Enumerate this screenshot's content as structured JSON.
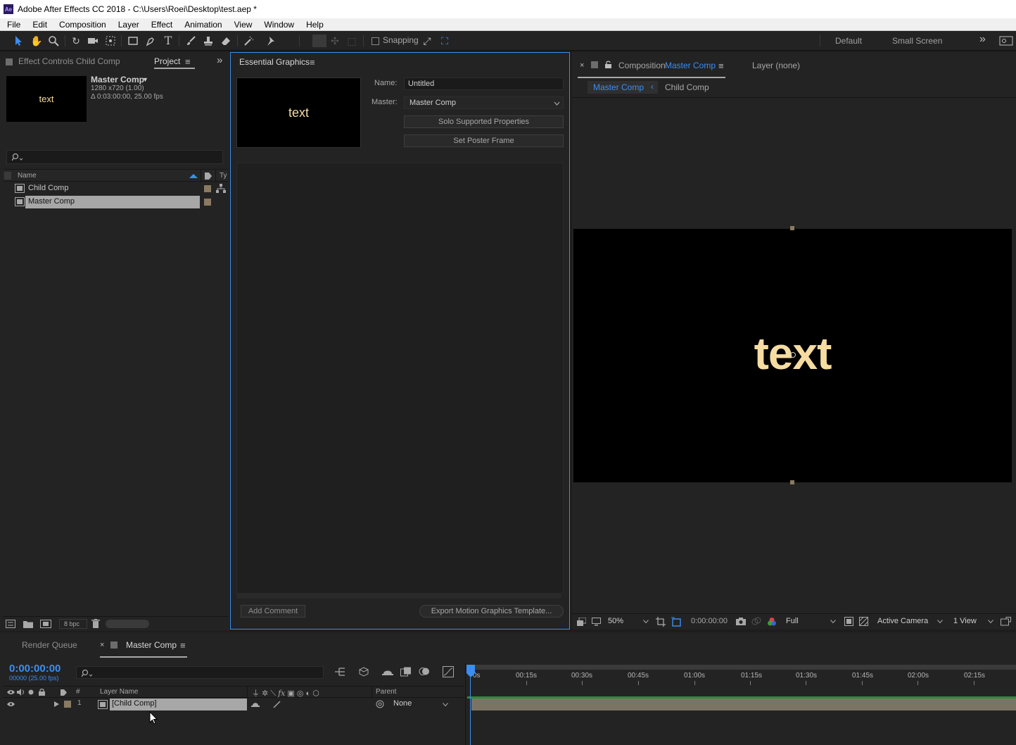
{
  "window": {
    "title": "Adobe After Effects CC 2018 - C:\\Users\\Roei\\Desktop\\test.aep *",
    "logo": "Ae"
  },
  "menu": [
    "File",
    "Edit",
    "Composition",
    "Layer",
    "Effect",
    "Animation",
    "View",
    "Window",
    "Help"
  ],
  "toolbar": {
    "snapping_label": "Snapping",
    "workspaces": [
      "Default",
      "Small Screen"
    ],
    "more": "»"
  },
  "project_panel": {
    "tab_effect_controls": "Effect Controls Child Comp",
    "tab_project": "Project",
    "comp_name": "Master Comp",
    "dropdown": "▼",
    "comp_size": "1280 x720 (1.00)",
    "comp_duration": "Δ 0:03:00:00, 25.00 fps",
    "thumb_text": "text",
    "search_placeholder": "",
    "col_name": "Name",
    "col_type": "Ty",
    "items": [
      {
        "name": "Child Comp",
        "selected": false
      },
      {
        "name": "Master Comp",
        "selected": true
      }
    ],
    "bpc": "8 bpc"
  },
  "essential_graphics": {
    "title": "Essential Graphics",
    "name_label": "Name:",
    "name_value": "Untitled",
    "master_label": "Master:",
    "master_value": "Master Comp",
    "solo_btn": "Solo Supported Properties",
    "poster_btn": "Set Poster Frame",
    "thumb_text": "text",
    "add_comment": "Add Comment",
    "export_btn": "Export Motion Graphics Template..."
  },
  "composition_panel": {
    "title_prefix": "Composition",
    "title_comp": "Master Comp",
    "layer_tab": "Layer  (none)",
    "breadcrumb": [
      "Master Comp",
      "Child Comp"
    ],
    "canvas_text": "text",
    "zoom": "50%",
    "timecode": "0:00:00:00",
    "resolution": "Full",
    "camera": "Active Camera",
    "views": "1 View"
  },
  "timeline": {
    "tab_render_queue": "Render Queue",
    "tab_master": "Master Comp",
    "timecode": "0:00:00:00",
    "frames": "00000 (25.00 fps)",
    "col_num": "#",
    "col_layer_name": "Layer Name",
    "col_parent": "Parent",
    "ruler": [
      "0s",
      "00:15s",
      "00:30s",
      "00:45s",
      "01:00s",
      "01:15s",
      "01:30s",
      "01:45s",
      "02:00s",
      "02:15s"
    ],
    "layers": [
      {
        "index": "1",
        "name": "[Child Comp]",
        "parent": "None"
      }
    ]
  },
  "colors": {
    "accent": "#3b8ef0",
    "canvas_text": "#f6dca0",
    "label_swatch": "#8a7a62"
  }
}
